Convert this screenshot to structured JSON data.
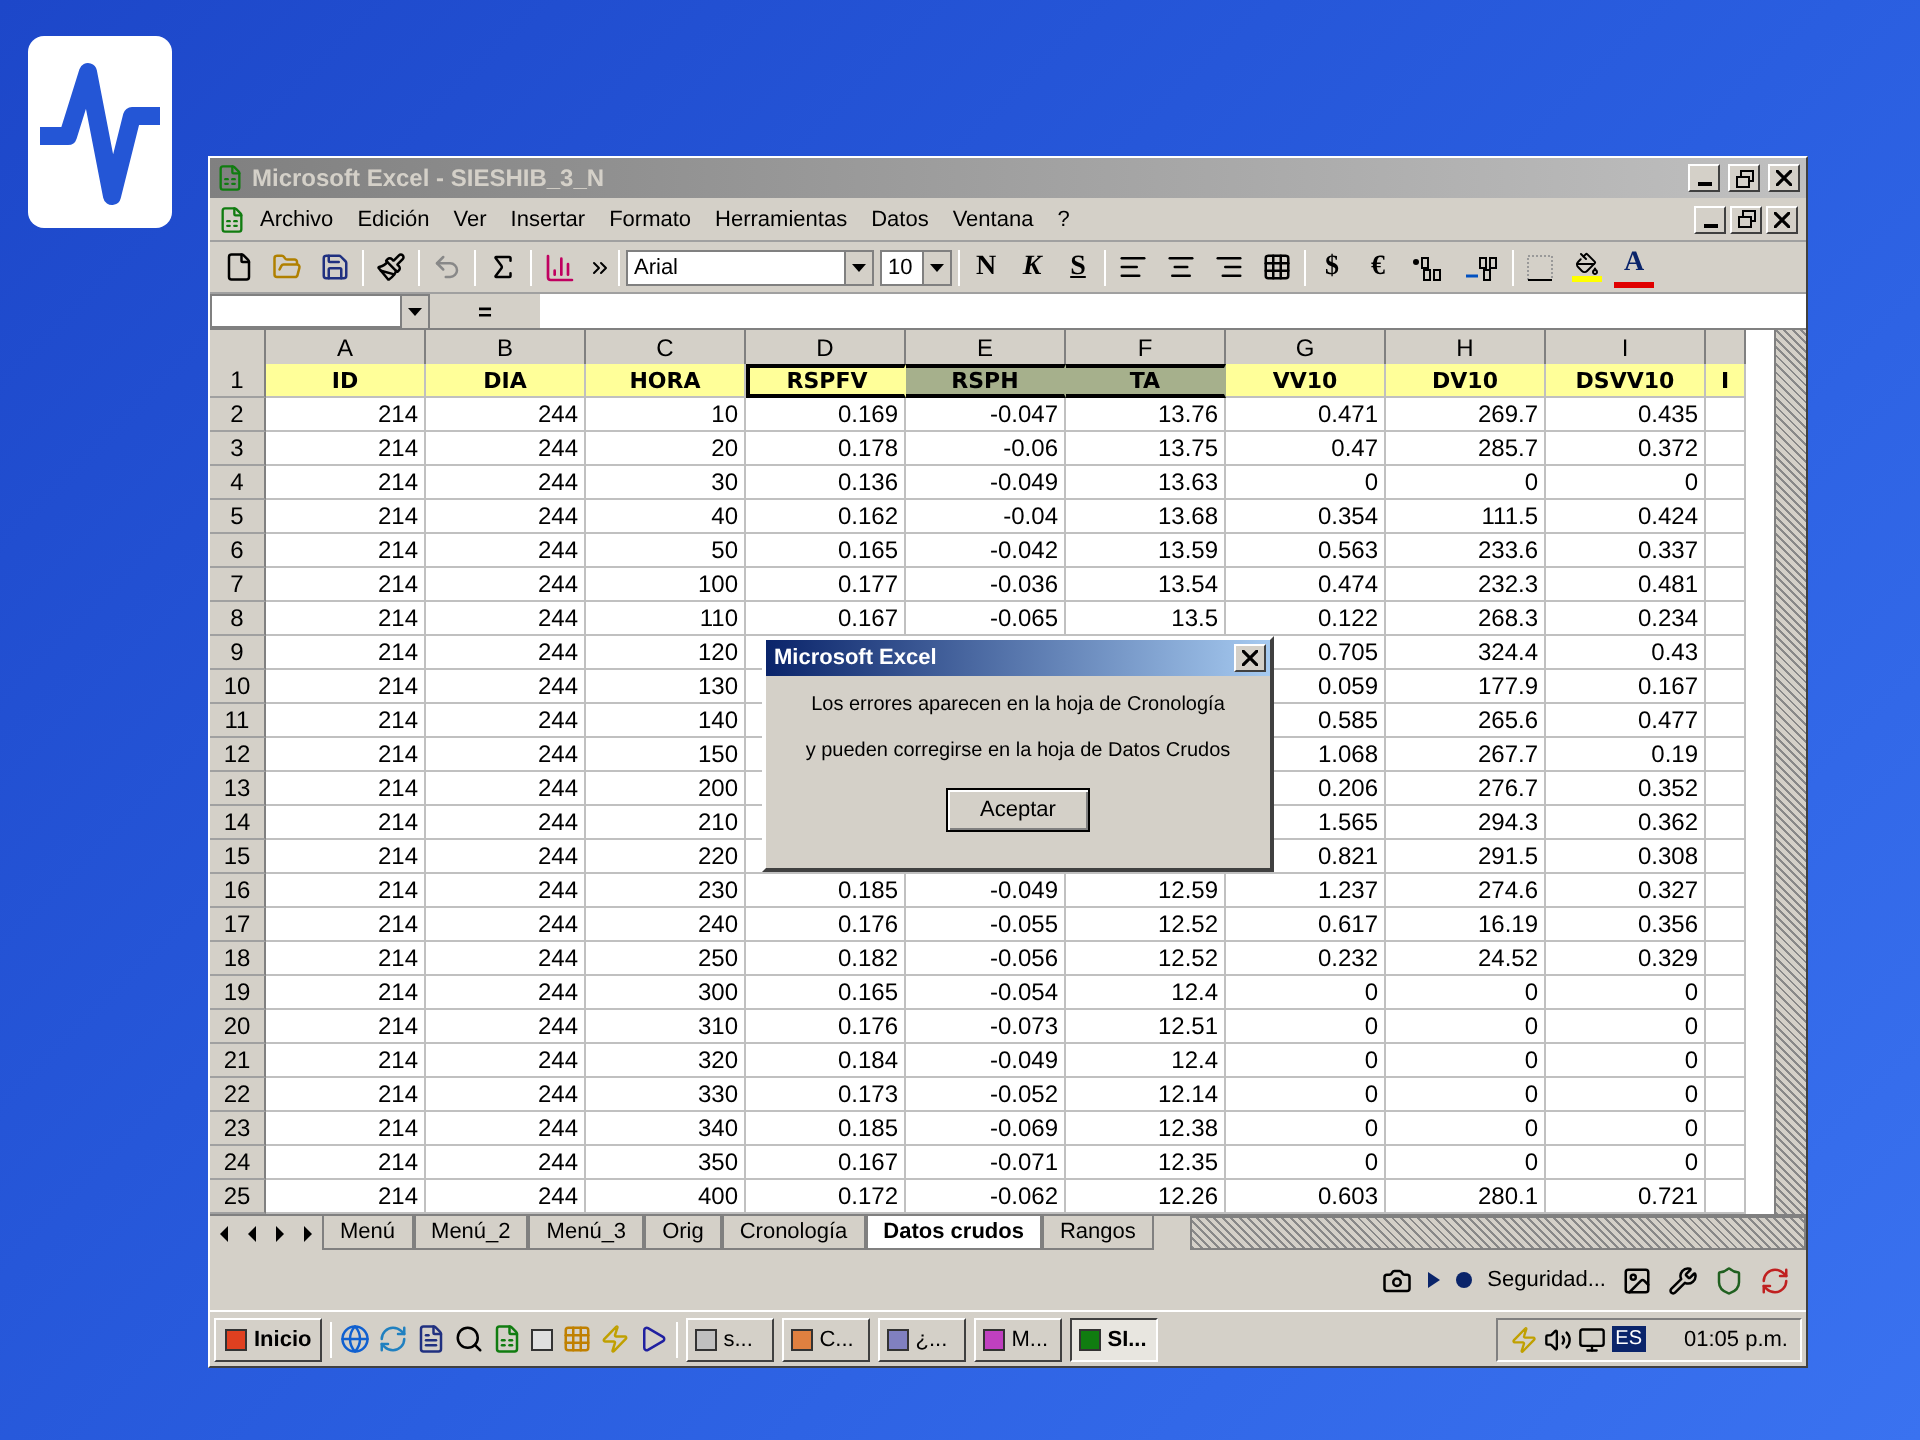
{
  "window": {
    "title": "Microsoft Excel - SIESHIB_3_N"
  },
  "menu": [
    "Archivo",
    "Edición",
    "Ver",
    "Insertar",
    "Formato",
    "Herramientas",
    "Datos",
    "Ventana",
    "?"
  ],
  "toolbar": {
    "font": "Arial",
    "size": "10",
    "bold": "N",
    "italic": "K",
    "underline": "S",
    "currency": "$",
    "euro": "€",
    "font_color": "A"
  },
  "formula_bar": {
    "equals": "="
  },
  "columns": [
    "A",
    "B",
    "C",
    "D",
    "E",
    "F",
    "G",
    "H",
    "I"
  ],
  "header_row": {
    "number": "1",
    "cells": [
      {
        "text": "ID",
        "selected": false,
        "active": false
      },
      {
        "text": "DIA",
        "selected": false,
        "active": false
      },
      {
        "text": "HORA",
        "selected": false,
        "active": false
      },
      {
        "text": "RSPFV",
        "selected": true,
        "active": true
      },
      {
        "text": "RSPH",
        "selected": true,
        "active": false
      },
      {
        "text": "TA",
        "selected": true,
        "active": false
      },
      {
        "text": "VV10",
        "selected": false,
        "active": false
      },
      {
        "text": "DV10",
        "selected": false,
        "active": false
      },
      {
        "text": "DSVV10",
        "selected": false,
        "active": false
      },
      {
        "text": "I",
        "selected": false,
        "active": false
      }
    ]
  },
  "rows": [
    {
      "number": "2",
      "cells": [
        "214",
        "244",
        "10",
        "0.169",
        "-0.047",
        "13.76",
        "0.471",
        "269.7",
        "0.435"
      ]
    },
    {
      "number": "3",
      "cells": [
        "214",
        "244",
        "20",
        "0.178",
        "-0.06",
        "13.75",
        "0.47",
        "285.7",
        "0.372"
      ]
    },
    {
      "number": "4",
      "cells": [
        "214",
        "244",
        "30",
        "0.136",
        "-0.049",
        "13.63",
        "0",
        "0",
        "0"
      ]
    },
    {
      "number": "5",
      "cells": [
        "214",
        "244",
        "40",
        "0.162",
        "-0.04",
        "13.68",
        "0.354",
        "111.5",
        "0.424"
      ]
    },
    {
      "number": "6",
      "cells": [
        "214",
        "244",
        "50",
        "0.165",
        "-0.042",
        "13.59",
        "0.563",
        "233.6",
        "0.337"
      ]
    },
    {
      "number": "7",
      "cells": [
        "214",
        "244",
        "100",
        "0.177",
        "-0.036",
        "13.54",
        "0.474",
        "232.3",
        "0.481"
      ]
    },
    {
      "number": "8",
      "cells": [
        "214",
        "244",
        "110",
        "0.167",
        "-0.065",
        "13.5",
        "0.122",
        "268.3",
        "0.234"
      ]
    },
    {
      "number": "9",
      "cells": [
        "214",
        "244",
        "120",
        null,
        null,
        null,
        "0.705",
        "324.4",
        "0.43"
      ]
    },
    {
      "number": "10",
      "cells": [
        "214",
        "244",
        "130",
        null,
        null,
        null,
        "0.059",
        "177.9",
        "0.167"
      ]
    },
    {
      "number": "11",
      "cells": [
        "214",
        "244",
        "140",
        null,
        null,
        null,
        "0.585",
        "265.6",
        "0.477"
      ]
    },
    {
      "number": "12",
      "cells": [
        "214",
        "244",
        "150",
        null,
        null,
        null,
        "1.068",
        "267.7",
        "0.19"
      ]
    },
    {
      "number": "13",
      "cells": [
        "214",
        "244",
        "200",
        null,
        null,
        null,
        "0.206",
        "276.7",
        "0.352"
      ]
    },
    {
      "number": "14",
      "cells": [
        "214",
        "244",
        "210",
        null,
        null,
        null,
        "1.565",
        "294.3",
        "0.362"
      ]
    },
    {
      "number": "15",
      "cells": [
        "214",
        "244",
        "220",
        null,
        null,
        null,
        "0.821",
        "291.5",
        "0.308"
      ]
    },
    {
      "number": "16",
      "cells": [
        "214",
        "244",
        "230",
        "0.185",
        "-0.049",
        "12.59",
        "1.237",
        "274.6",
        "0.327"
      ]
    },
    {
      "number": "17",
      "cells": [
        "214",
        "244",
        "240",
        "0.176",
        "-0.055",
        "12.52",
        "0.617",
        "16.19",
        "0.356"
      ]
    },
    {
      "number": "18",
      "cells": [
        "214",
        "244",
        "250",
        "0.182",
        "-0.056",
        "12.52",
        "0.232",
        "24.52",
        "0.329"
      ]
    },
    {
      "number": "19",
      "cells": [
        "214",
        "244",
        "300",
        "0.165",
        "-0.054",
        "12.4",
        "0",
        "0",
        "0"
      ]
    },
    {
      "number": "20",
      "cells": [
        "214",
        "244",
        "310",
        "0.176",
        "-0.073",
        "12.51",
        "0",
        "0",
        "0"
      ]
    },
    {
      "number": "21",
      "cells": [
        "214",
        "244",
        "320",
        "0.184",
        "-0.049",
        "12.4",
        "0",
        "0",
        "0"
      ]
    },
    {
      "number": "22",
      "cells": [
        "214",
        "244",
        "330",
        "0.173",
        "-0.052",
        "12.14",
        "0",
        "0",
        "0"
      ]
    },
    {
      "number": "23",
      "cells": [
        "214",
        "244",
        "340",
        "0.185",
        "-0.069",
        "12.38",
        "0",
        "0",
        "0"
      ]
    },
    {
      "number": "24",
      "cells": [
        "214",
        "244",
        "350",
        "0.167",
        "-0.071",
        "12.35",
        "0",
        "0",
        "0"
      ]
    },
    {
      "number": "25",
      "cells": [
        "214",
        "244",
        "400",
        "0.172",
        "-0.062",
        "12.26",
        "0.603",
        "280.1",
        "0.721"
      ]
    }
  ],
  "sheet_tabs": [
    {
      "label": "Menú",
      "selected": false
    },
    {
      "label": "Menú_2",
      "selected": false
    },
    {
      "label": "Menú_3",
      "selected": false
    },
    {
      "label": "Orig",
      "selected": false
    },
    {
      "label": "Cronología",
      "selected": false
    },
    {
      "label": "Datos crudos",
      "selected": true
    },
    {
      "label": "Rangos",
      "selected": false
    }
  ],
  "dialog": {
    "title": "Microsoft Excel",
    "lines": [
      "Los errores aparecen en la hoja de Cronología",
      "y pueden corregirse en la hoja de Datos Crudos"
    ],
    "button": "Aceptar"
  },
  "drawing_toolbar": {
    "label": "Seguridad..."
  },
  "taskbar": {
    "start": "Inicio",
    "tasks": [
      {
        "label": "s...",
        "selected": false
      },
      {
        "label": "C...",
        "selected": false
      },
      {
        "label": "¿...",
        "selected": false
      },
      {
        "label": "M...",
        "selected": false
      },
      {
        "label": "SI...",
        "selected": true
      }
    ],
    "language": "ES",
    "clock": "01:05 p.m."
  }
}
